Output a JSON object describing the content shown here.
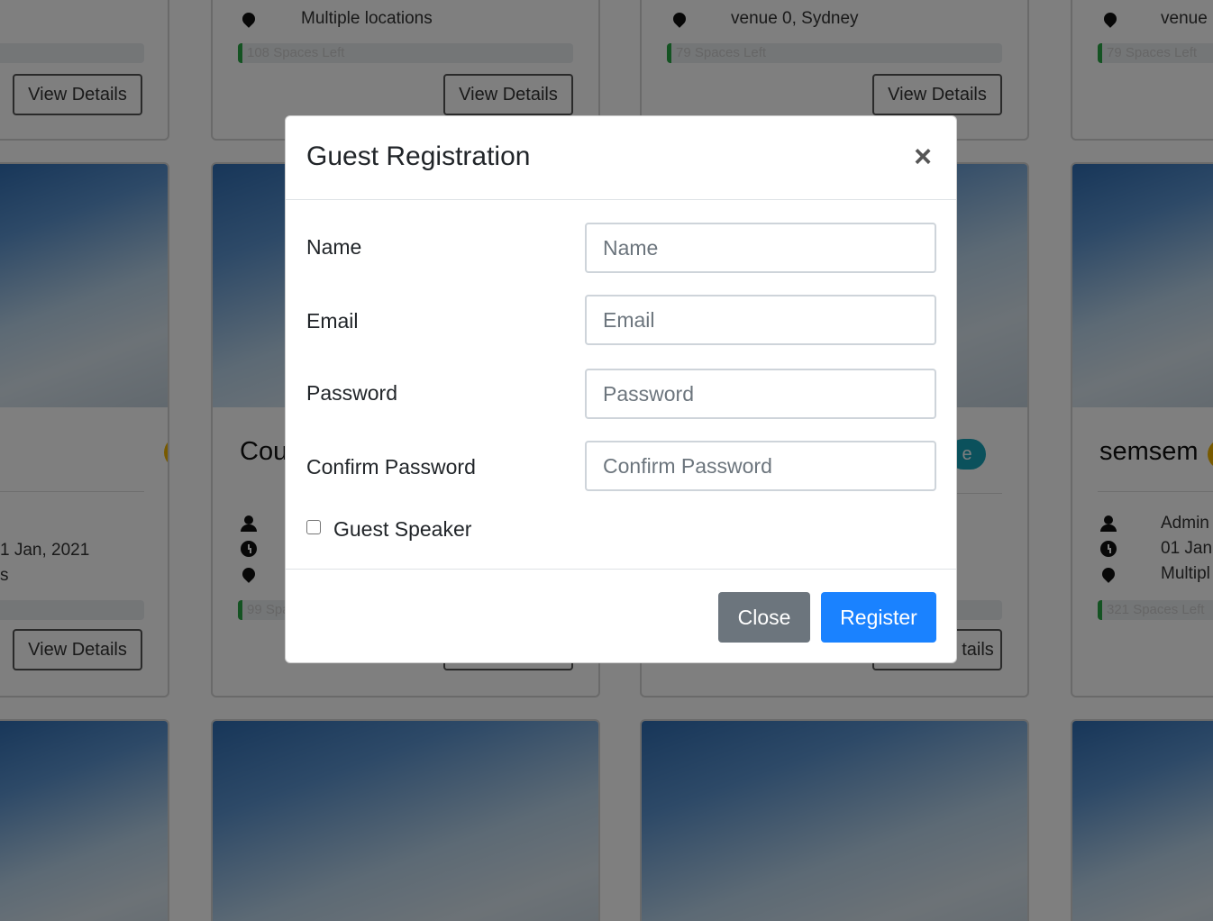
{
  "background": {
    "view_details_label": "View Details",
    "partial_view_details_label": "tails",
    "top_row": [
      {
        "location": "",
        "spaces": ""
      },
      {
        "location": "Multiple locations",
        "spaces": "108 Spaces Left"
      },
      {
        "location": "venue 0, Sydney",
        "spaces": "79 Spaces Left"
      },
      {
        "location": "venue",
        "spaces": "79 Spaces Left"
      }
    ],
    "mid_row": [
      {
        "title": "",
        "date": "1 Jan, 2021",
        "location": "s"
      },
      {
        "title": "Cou",
        "spaces": "99 Spa"
      },
      {
        "title": "",
        "badge_text": "e"
      },
      {
        "title": "semsem",
        "organizer": "Admin",
        "date": "01 Jan",
        "location": "Multipl",
        "spaces": "321 Spaces Left"
      }
    ]
  },
  "modal": {
    "title": "Guest Registration",
    "close_symbol": "×",
    "fields": [
      {
        "label": "Name",
        "placeholder": "Name",
        "value": ""
      },
      {
        "label": "Email",
        "placeholder": "Email",
        "value": ""
      },
      {
        "label": "Password",
        "placeholder": "Password",
        "value": ""
      },
      {
        "label": "Confirm Password",
        "placeholder": "Confirm Password",
        "value": ""
      }
    ],
    "guest_speaker_label": "Guest Speaker",
    "guest_speaker_checked": false,
    "close_button": "Close",
    "register_button": "Register"
  },
  "colors": {
    "primary": "#1a82ff",
    "secondary": "#6c757d",
    "progress_fill": "#28a745",
    "badge_yellow": "#f0b400",
    "badge_teal": "#17a2b8"
  }
}
